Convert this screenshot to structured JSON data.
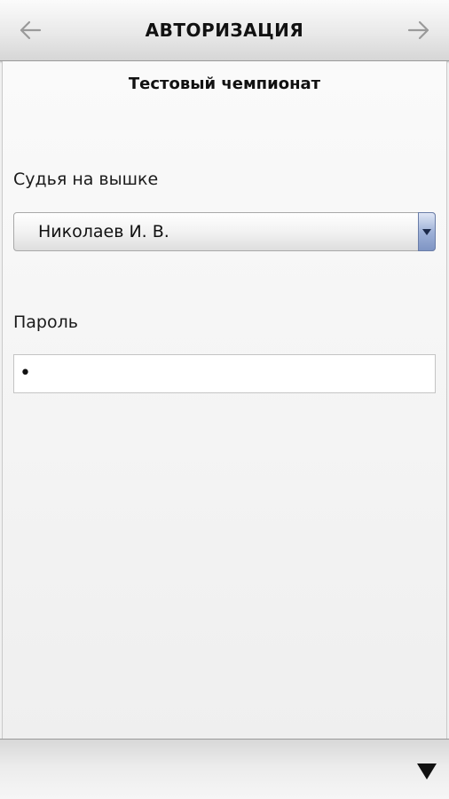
{
  "header": {
    "title": "АВТОРИЗАЦИЯ",
    "back_icon": "arrow-left-icon",
    "forward_icon": "arrow-right-icon"
  },
  "main": {
    "subtitle": "Тестовый чемпионат",
    "judge": {
      "label": "Судья на вышке",
      "selected": "Николаев И. В."
    },
    "password": {
      "label": "Пароль",
      "value_masked": "•"
    }
  },
  "footer": {
    "menu_icon": "overflow-menu-icon"
  }
}
